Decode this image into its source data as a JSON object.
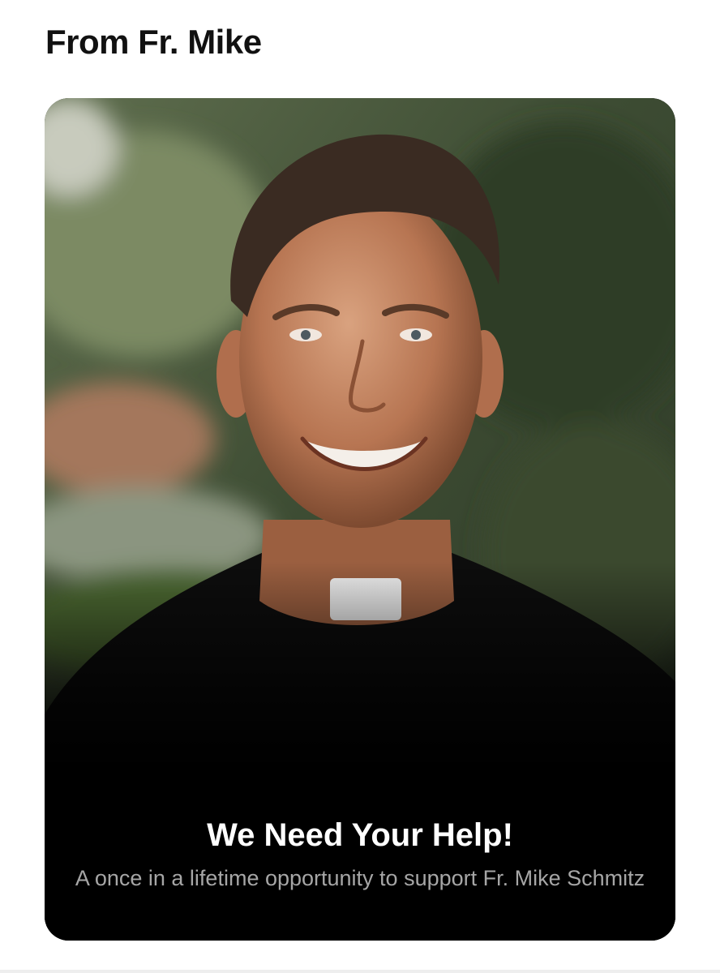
{
  "section": {
    "title": "From Fr. Mike"
  },
  "card": {
    "title": "We Need Your Help!",
    "subtitle": "A once in a lifetime opportunity to support Fr. Mike Schmitz",
    "image_alt": "Smiling priest in clerical collar outdoors"
  },
  "colors": {
    "card_background": "#000000",
    "title_text": "#ffffff",
    "subtitle_text": "#a6a6a6",
    "heading_text": "#111111"
  }
}
